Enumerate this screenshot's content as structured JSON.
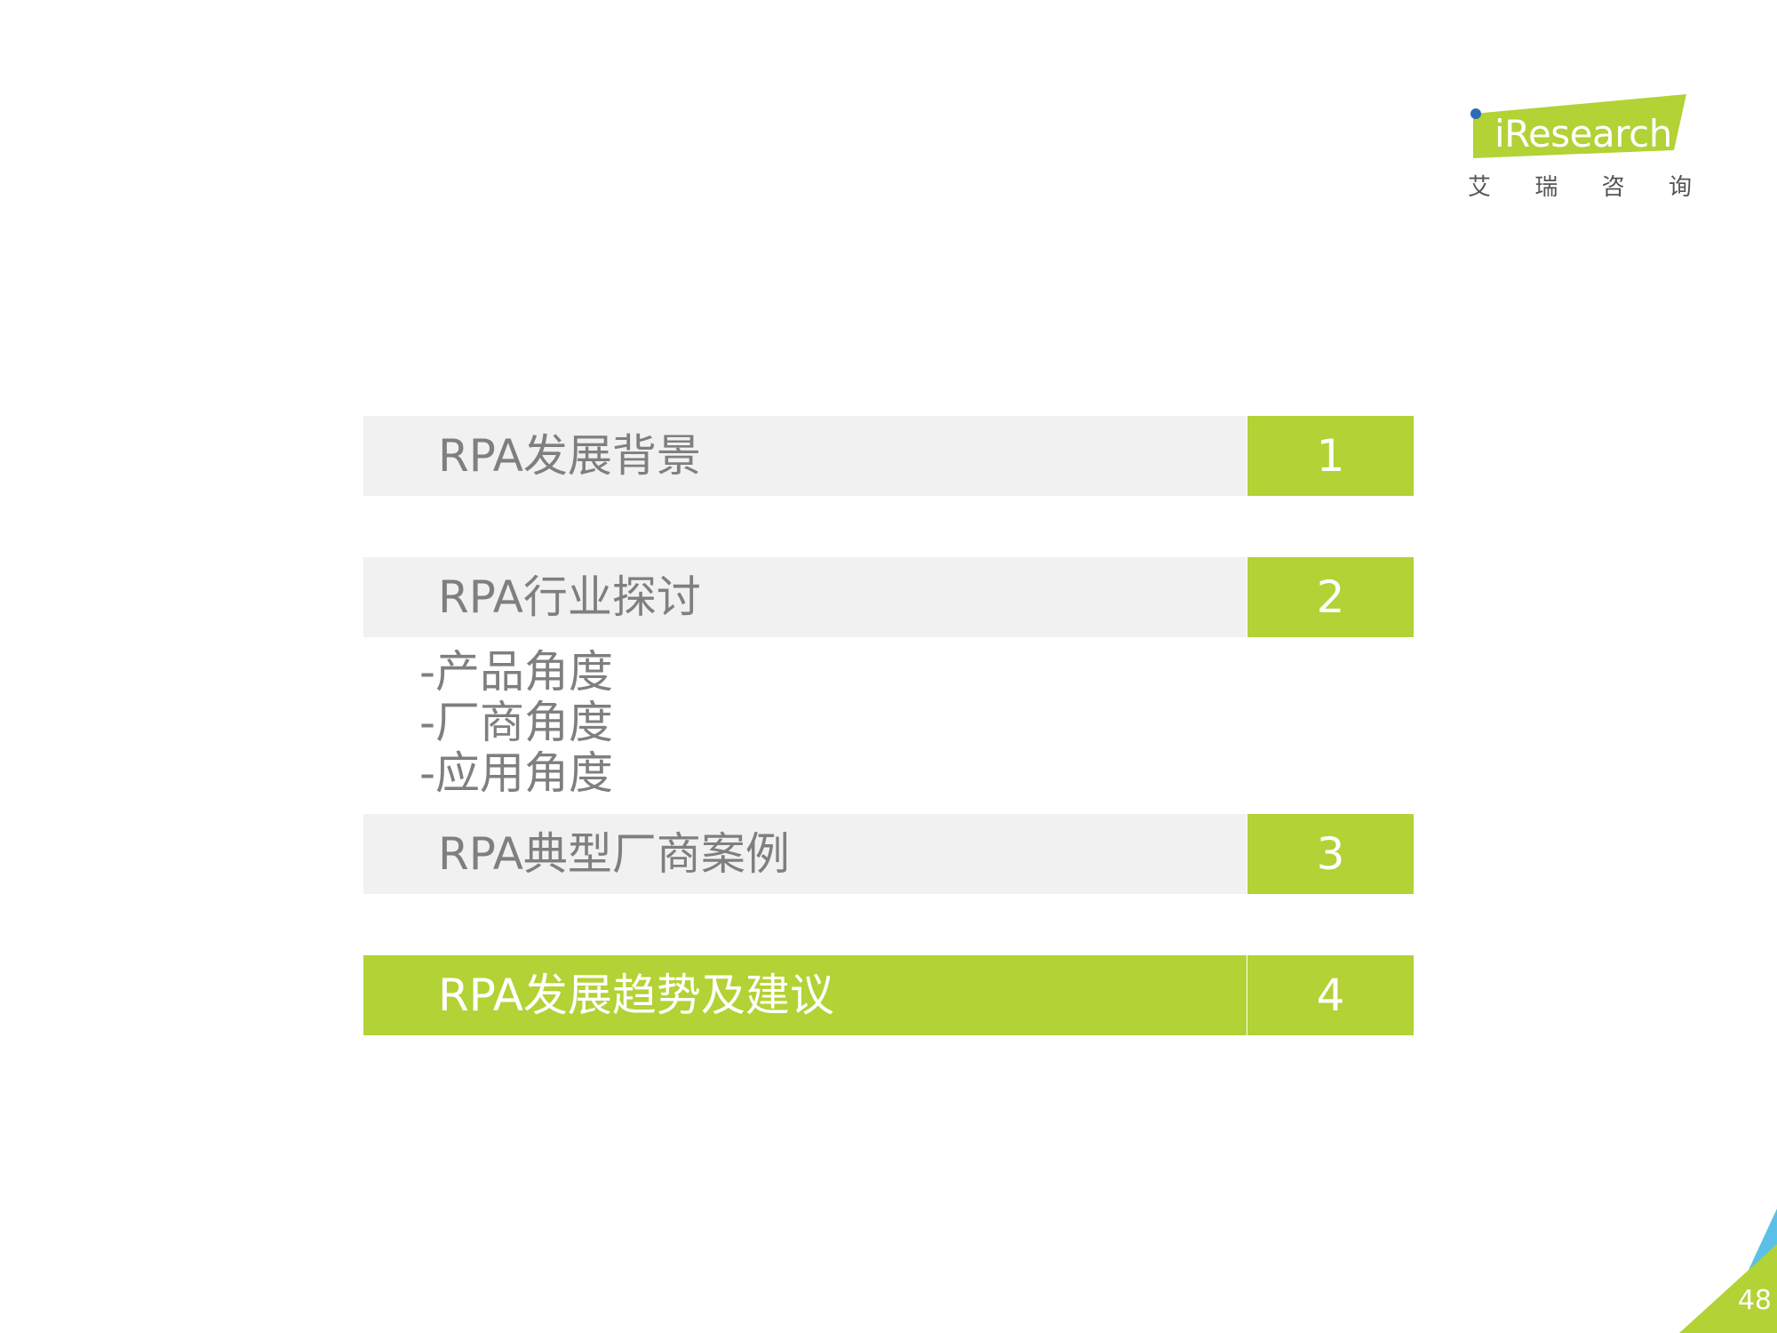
{
  "logo": {
    "wordmark": "iResearch",
    "cn_chars": [
      "艾",
      "瑞",
      "咨",
      "询"
    ],
    "colors": {
      "green": "#b2d235",
      "blue": "#2e6db4"
    }
  },
  "toc": [
    {
      "label": "RPA发展背景",
      "number": "1",
      "active": false
    },
    {
      "label": "RPA行业探讨",
      "number": "2",
      "active": false,
      "subitems": [
        "-产品角度",
        "-厂商角度",
        "-应用角度"
      ]
    },
    {
      "label": "RPA典型厂商案例",
      "number": "3",
      "active": false
    },
    {
      "label": "RPA发展趋势及建议",
      "number": "4",
      "active": true
    }
  ],
  "page_number": "48",
  "colors": {
    "accent": "#b2d235",
    "row_bg": "#f1f1f1",
    "text_gray": "#7f7f7f",
    "corner_blue": "#5bc0e8"
  }
}
